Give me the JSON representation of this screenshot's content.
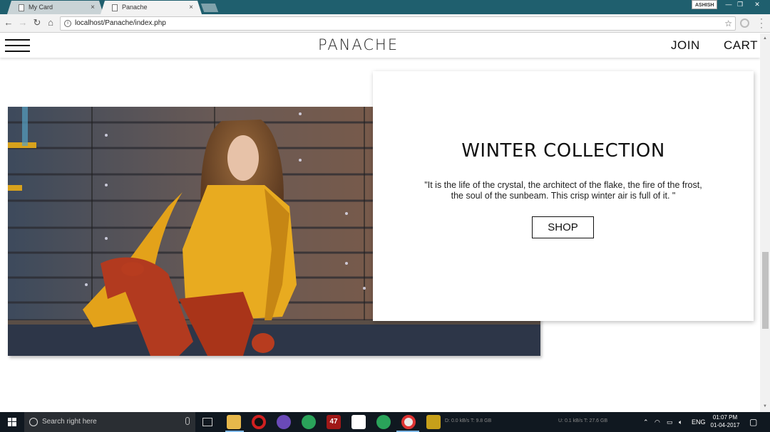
{
  "browser": {
    "tabs": [
      {
        "title": "My Card",
        "close": "×"
      },
      {
        "title": "Panache",
        "close": "×"
      }
    ],
    "user": "ASHISH",
    "window_controls": {
      "minimize": "—",
      "restore": "❐",
      "close": "✕"
    },
    "url": "localhost/Panache/index.php",
    "nav": {
      "back": "←",
      "forward": "→",
      "reload": "↻",
      "home": "⌂"
    },
    "star": "☆"
  },
  "site": {
    "logo": "PANACHE",
    "nav": {
      "join": "JOIN",
      "cart": "CART"
    },
    "card": {
      "title": "WINTER COLLECTION",
      "quote": "\"It is the life of the crystal, the architect of the flake, the fire of the frost, the soul of the sunbeam. This crisp winter air is full of it. \"",
      "button": "SHOP"
    }
  },
  "taskbar": {
    "search_placeholder": "Search right here",
    "badge_47": "47",
    "net1": "D: 0.0 kB/s  T: 9.8 GB",
    "net2": "U: 0.1 kB/s  T: 27.6 GB",
    "lang": "ENG",
    "time": "01:07 PM",
    "date": "01-04-2017"
  },
  "icons": {
    "page": "page-icon",
    "menu": "hamburger-menu-icon",
    "start": "windows-start-icon"
  },
  "colors": {
    "tab_bar": "#1f5f6e",
    "taskbar": "#101820",
    "sweater": "#e3a21a",
    "leggings": "#b23a1f"
  }
}
